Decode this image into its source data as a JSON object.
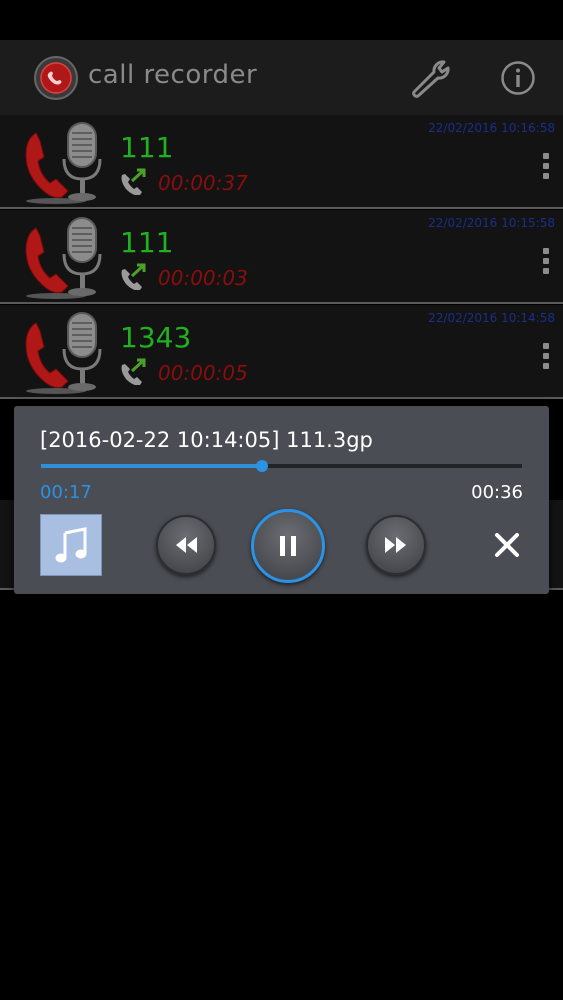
{
  "app": {
    "title": "call recorder",
    "accent_color": "#2b93e6",
    "number_color": "#20b020",
    "duration_color": "#8b0d0d"
  },
  "header": {
    "logo_icon": "call-recorder-logo-icon",
    "settings_icon": "wrench-icon",
    "info_icon": "info-icon"
  },
  "recordings": [
    {
      "number": "111",
      "duration": "00:00:37",
      "date": "22/02/2016 10:16:58",
      "direction_icon": "outgoing-call-icon"
    },
    {
      "number": "111",
      "duration": "00:00:03",
      "date": "22/02/2016 10:15:58",
      "direction_icon": "outgoing-call-icon"
    },
    {
      "number": "1343",
      "duration": "00:00:05",
      "date": "22/02/2016 10:14:58",
      "direction_icon": "outgoing-call-icon"
    }
  ],
  "player": {
    "title": "[2016-02-22 10:14:05] 111.3gp",
    "current_time": "00:17",
    "total_time": "00:36",
    "progress": 0.46,
    "art_icon": "music-note-icon",
    "rewind_icon": "rewind-icon",
    "pause_icon": "pause-icon",
    "forward_icon": "fast-forward-icon",
    "close_icon": "close-icon"
  }
}
